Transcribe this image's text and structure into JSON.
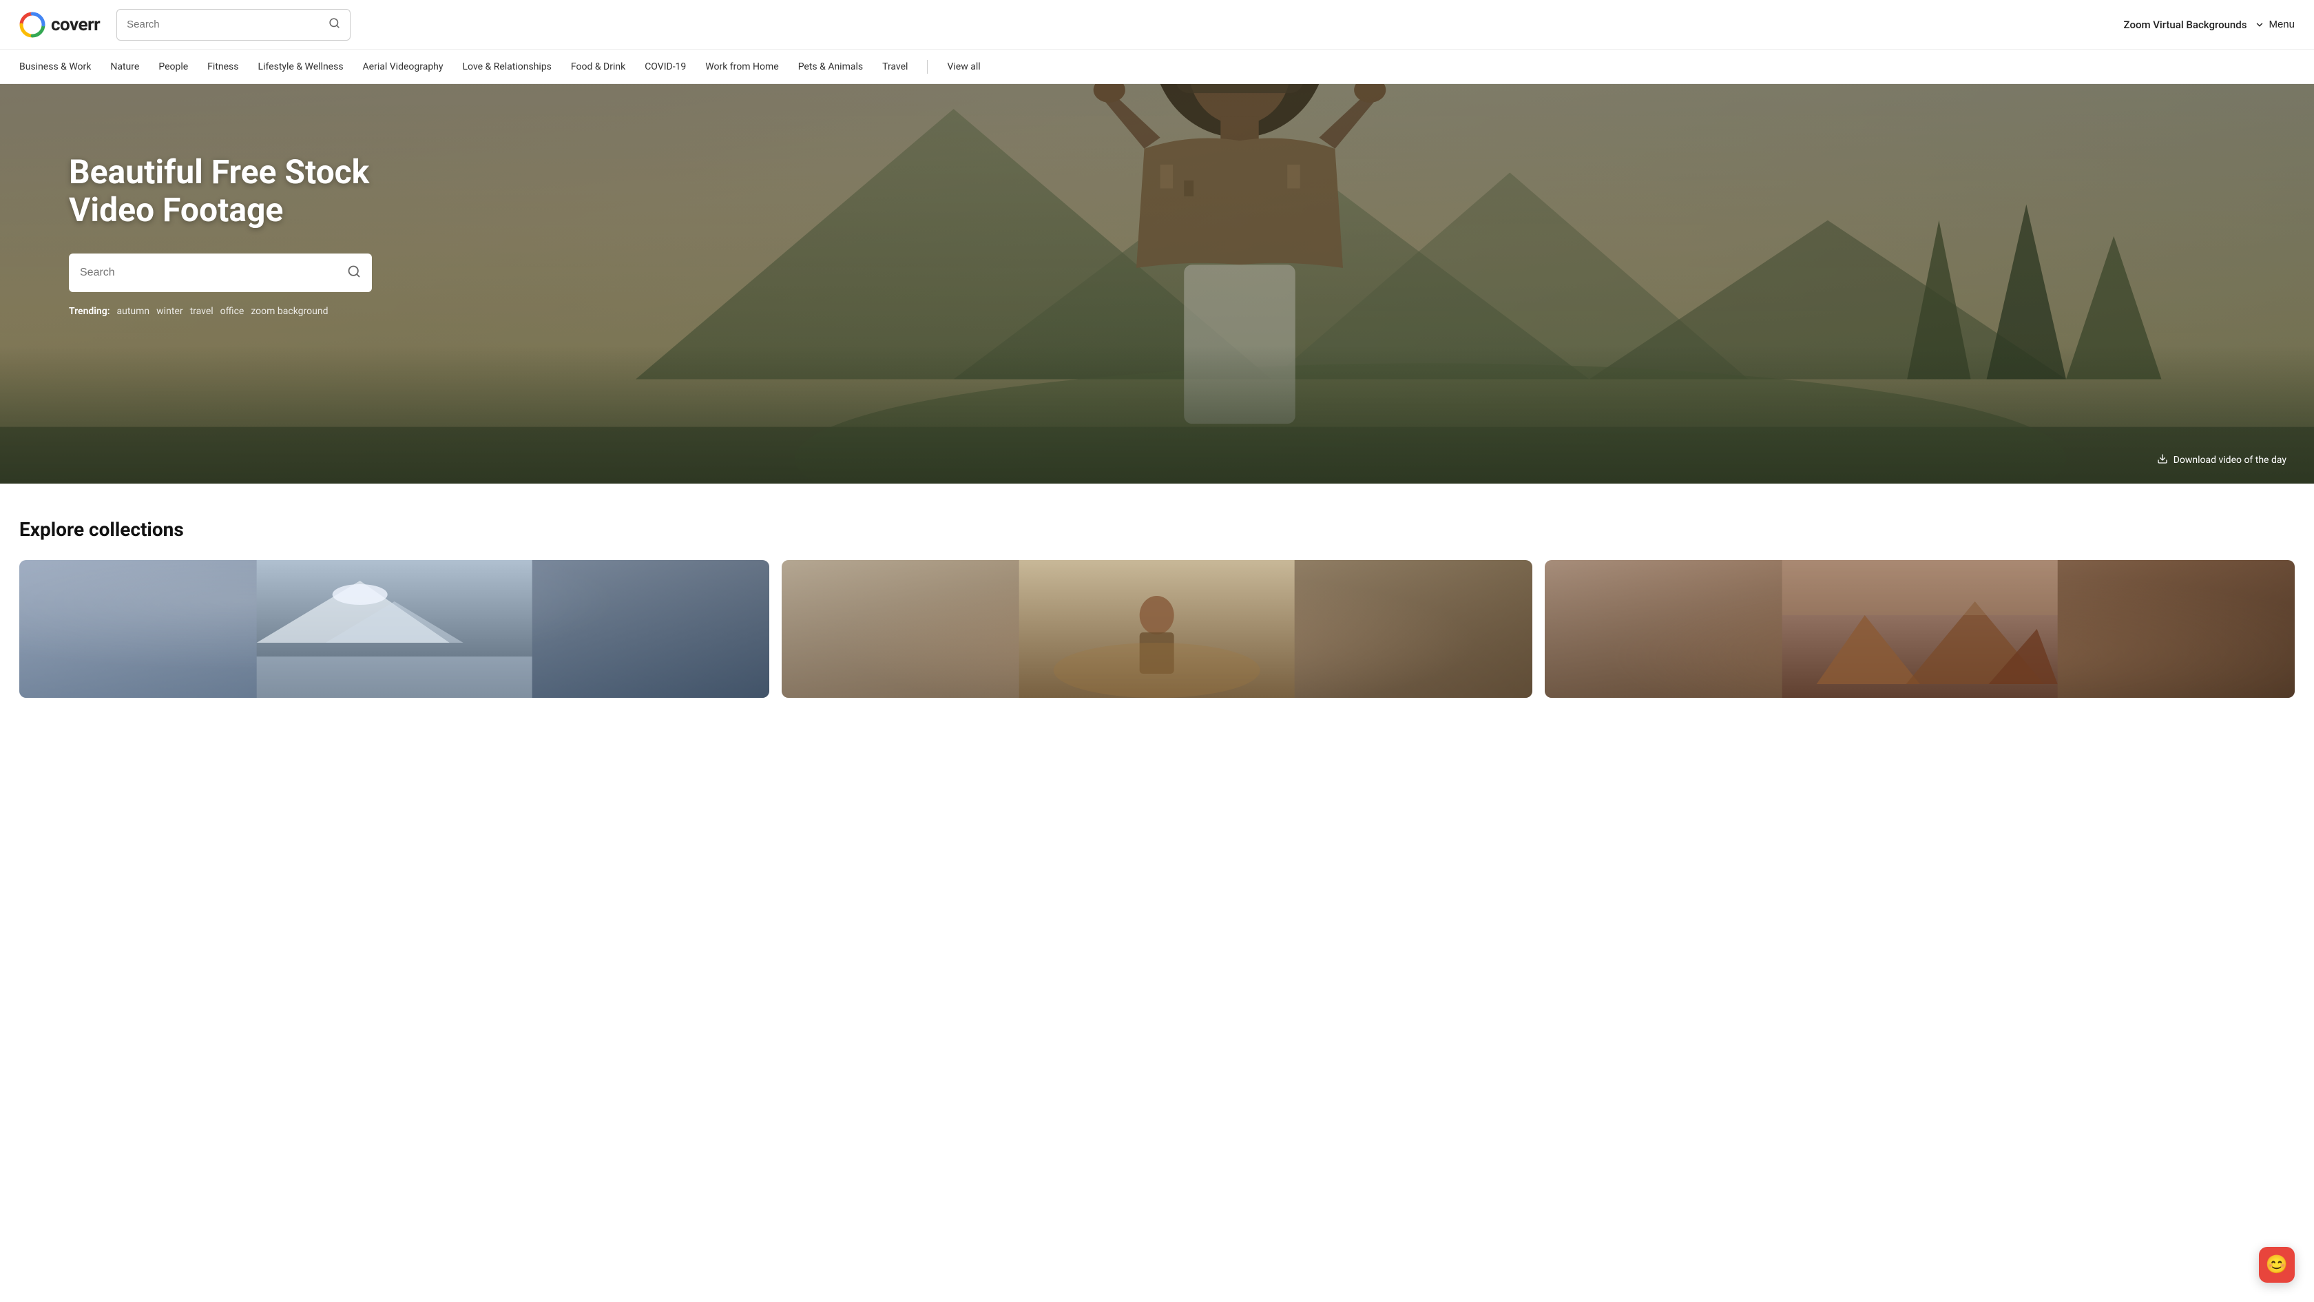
{
  "header": {
    "logo_text": "coverr",
    "search_placeholder": "Search",
    "zoom_bg_label": "Zoom Virtual Backgrounds",
    "menu_label": "Menu"
  },
  "nav": {
    "items": [
      {
        "label": "Business & Work",
        "key": "business-work"
      },
      {
        "label": "Nature",
        "key": "nature"
      },
      {
        "label": "People",
        "key": "people"
      },
      {
        "label": "Fitness",
        "key": "fitness"
      },
      {
        "label": "Lifestyle & Wellness",
        "key": "lifestyle-wellness"
      },
      {
        "label": "Aerial Videography",
        "key": "aerial-videography"
      },
      {
        "label": "Love & Relationships",
        "key": "love-relationships"
      },
      {
        "label": "Food & Drink",
        "key": "food-drink"
      },
      {
        "label": "COVID-19",
        "key": "covid-19"
      },
      {
        "label": "Work from Home",
        "key": "work-from-home"
      },
      {
        "label": "Pets & Animals",
        "key": "pets-animals"
      },
      {
        "label": "Travel",
        "key": "travel"
      }
    ],
    "view_all_label": "View all"
  },
  "hero": {
    "title_line1": "Beautiful Free Stock",
    "title_line2": "Video Footage",
    "search_placeholder": "Search",
    "trending_label": "Trending:",
    "trending_tags": [
      {
        "label": "autumn",
        "key": "autumn"
      },
      {
        "label": "winter",
        "key": "winter"
      },
      {
        "label": "travel",
        "key": "travel"
      },
      {
        "label": "office",
        "key": "office"
      },
      {
        "label": "zoom background",
        "key": "zoom-background"
      }
    ],
    "download_label": "Download video of the day"
  },
  "collections": {
    "section_title": "Explore collections",
    "cards": [
      {
        "key": "card-1",
        "style": "snow"
      },
      {
        "key": "card-2",
        "style": "person"
      },
      {
        "key": "card-3",
        "style": "rocks"
      }
    ]
  },
  "chat_widget": {
    "icon": "😊"
  }
}
